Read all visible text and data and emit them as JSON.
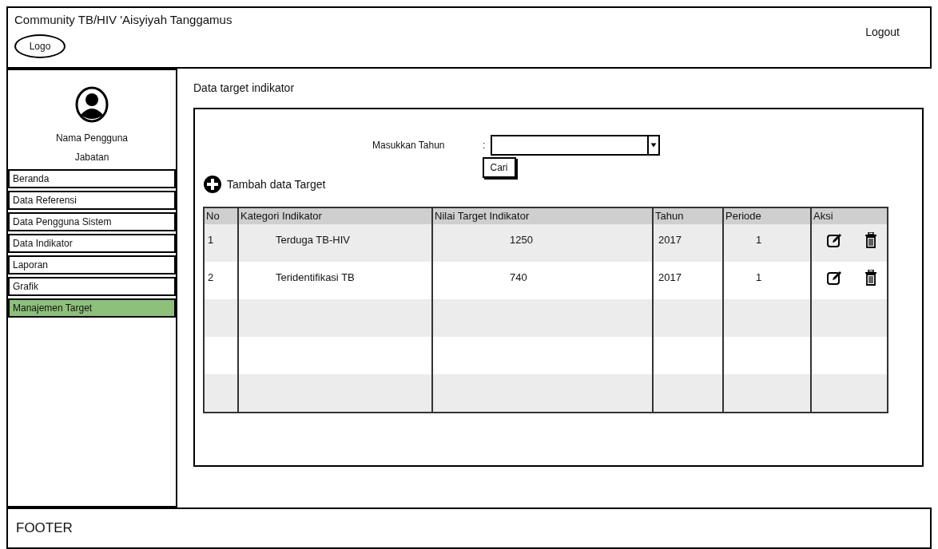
{
  "header": {
    "title": "Community TB/HIV 'Aisyiyah Tanggamus",
    "logo": "Logo",
    "logout": "Logout"
  },
  "sidebar": {
    "user_name": "Nama Pengguna",
    "role": "Jabatan",
    "items": [
      {
        "label": "Beranda",
        "selected": false
      },
      {
        "label": "Data Referensi",
        "selected": false
      },
      {
        "label": "Data Pengguna Sistem",
        "selected": false
      },
      {
        "label": "Data Indikator",
        "selected": false
      },
      {
        "label": "Laporan",
        "selected": false
      },
      {
        "label": "Grafik",
        "selected": false
      },
      {
        "label": "Manajemen Target",
        "selected": true
      }
    ]
  },
  "page_title": "Data target indikator",
  "filter": {
    "label": "Masukkan Tahun",
    "separator": ":",
    "button": "Cari"
  },
  "add_link": "Tambah data Target",
  "table": {
    "columns": [
      "No",
      "Kategori Indikator",
      "Nilai Target Indikator",
      "Tahun",
      "Periode",
      "Aksi"
    ],
    "rows": [
      {
        "cells": [
          "1",
          "Terduga TB-HIV",
          "1250",
          "2017",
          "1"
        ]
      },
      {
        "cells": [
          "2",
          "Teridentifikasi TB",
          "740",
          "2017",
          "1"
        ]
      }
    ]
  },
  "footer": "FOOTER"
}
